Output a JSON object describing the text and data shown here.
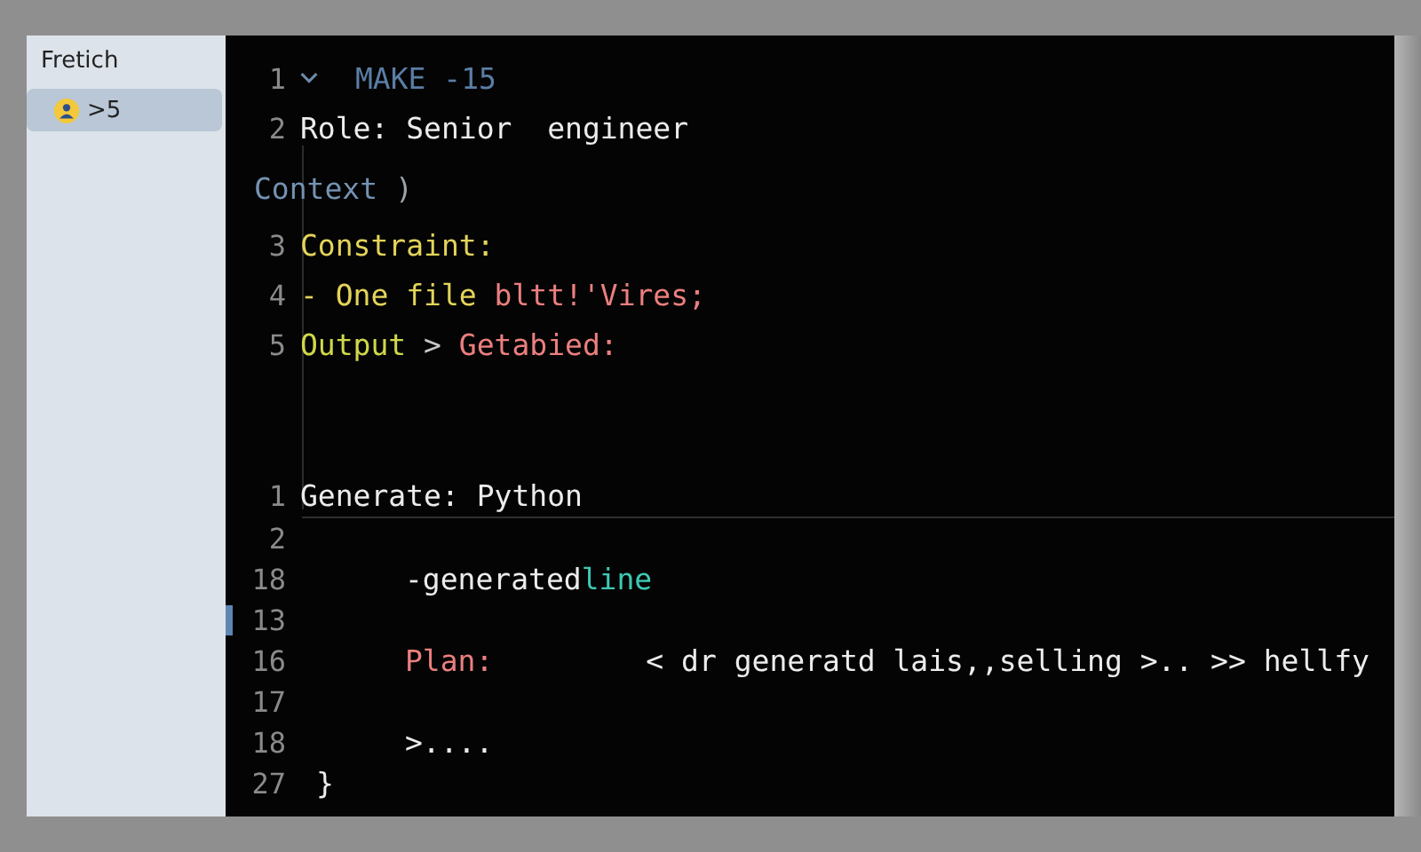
{
  "sidebar": {
    "title": "Fretich",
    "items": [
      {
        "label": ">5",
        "selected": true
      }
    ]
  },
  "editor": {
    "blocks": [
      {
        "lines": [
          {
            "kind": "code",
            "number": "1",
            "expanded": true,
            "segments": [
              {
                "text": "MAKE -15",
                "color": "#5a7ea4"
              }
            ]
          },
          {
            "kind": "code",
            "number": "2",
            "segments": [
              {
                "text": "Role: Senior  engineer",
                "color": "#ececec"
              }
            ]
          },
          {
            "kind": "heading",
            "segments": [
              {
                "text": "Context ",
                "color": "#7492b2"
              },
              {
                "text": ")",
                "color": "#9aa4ae"
              }
            ]
          },
          {
            "kind": "code",
            "number": "3",
            "segments": [
              {
                "text": "Constraint:",
                "color": "#e4d45a"
              }
            ]
          },
          {
            "kind": "code",
            "number": "4",
            "segments": [
              {
                "text": "- One file ",
                "color": "#e4d45a"
              },
              {
                "text": "bltt!'Vires;",
                "color": "#ec7f7f"
              }
            ]
          },
          {
            "kind": "code",
            "number": "5",
            "segments": [
              {
                "text": "Output ",
                "color": "#cfd84a"
              },
              {
                "text": "> ",
                "color": "#c8c8c8"
              },
              {
                "text": "Getabied:",
                "color": "#ec7f7f"
              }
            ]
          }
        ]
      },
      {
        "lines": [
          {
            "kind": "code",
            "number": "1",
            "segments": [
              {
                "text": "Generate: Python",
                "color": "#ececec"
              }
            ],
            "children": [
              {
                "kind": "code",
                "number": "2"
              },
              {
                "kind": "code",
                "number": "18",
                "segments": [
                  {
                    "text": "-generated",
                    "color": "#ececec"
                  },
                  {
                    "text": "line",
                    "color": "#3ec9b4"
                  }
                ]
              },
              {
                "kind": "code",
                "number": "13",
                "marked": true
              },
              {
                "kind": "columns",
                "number": "16",
                "segments": [
                  {
                    "text": "Plan:",
                    "color": "#ec7f7f"
                  },
                  {
                    "text": "< dr generatd lais,,selling >.. >> hellfy",
                    "color": "#ececec"
                  }
                ]
              },
              {
                "kind": "code",
                "number": "17"
              },
              {
                "kind": "code",
                "number": "18",
                "segments": [
                  {
                    "text": ">....",
                    "color": "#ececec"
                  }
                ]
              }
            ]
          },
          {
            "kind": "close",
            "number": "27",
            "segments": [
              {
                "text": "}",
                "color": "#ececec"
              }
            ]
          }
        ]
      }
    ]
  }
}
